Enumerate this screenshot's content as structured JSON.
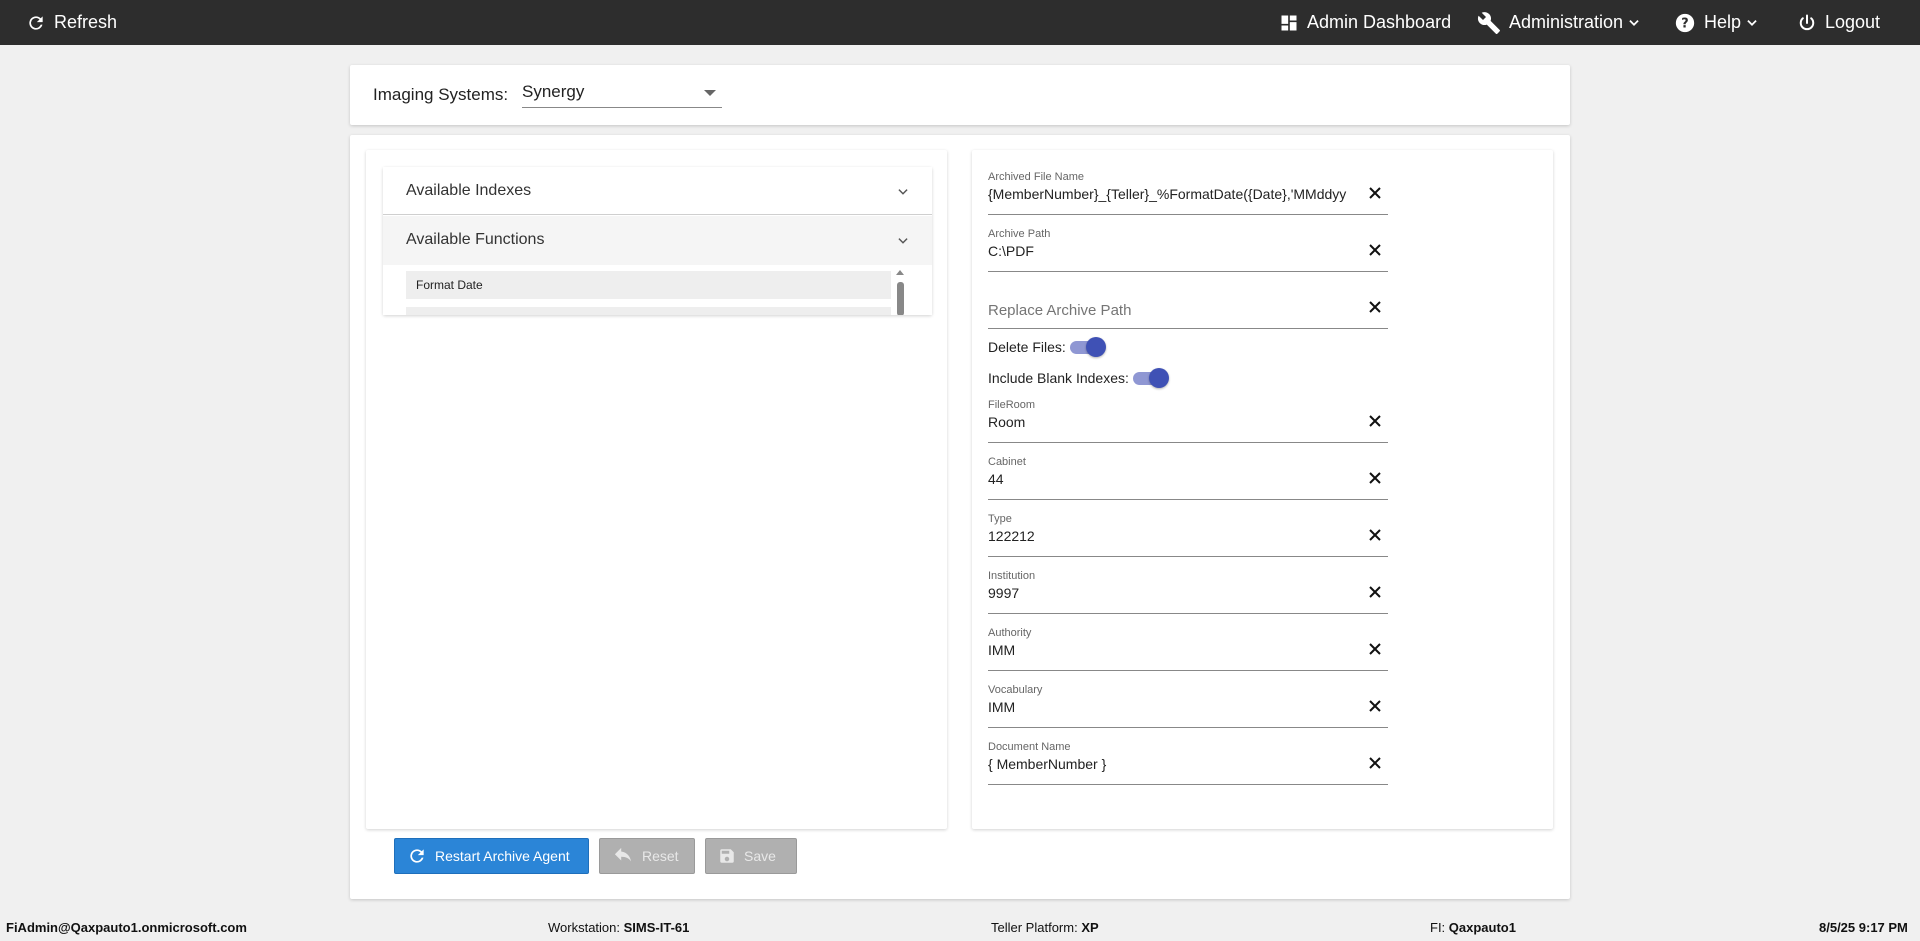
{
  "topbar": {
    "refresh_label": "Refresh",
    "admin_dashboard_label": "Admin Dashboard",
    "administration_label": "Administration",
    "help_label": "Help",
    "logout_label": "Logout"
  },
  "imaging": {
    "label": "Imaging Systems:",
    "selected": "Synergy"
  },
  "accordion": {
    "indexes_title": "Available Indexes",
    "functions_title": "Available Functions",
    "functions": [
      "Format Date"
    ]
  },
  "fields": {
    "archived_file_name": {
      "label": "Archived File Name",
      "value": "{MemberNumber}_{Teller}_%FormatDate({Date},'MMddyy"
    },
    "archive_path": {
      "label": "Archive Path",
      "value": "C:\\PDF"
    },
    "replace_archive_path": {
      "placeholder": "Replace Archive Path"
    },
    "fileroom": {
      "label": "FileRoom",
      "value": "Room"
    },
    "cabinet": {
      "label": "Cabinet",
      "value": "44"
    },
    "type": {
      "label": "Type",
      "value": "122212"
    },
    "institution": {
      "label": "Institution",
      "value": "9997"
    },
    "authority": {
      "label": "Authority",
      "value": "IMM"
    },
    "vocabulary": {
      "label": "Vocabulary",
      "value": "IMM"
    },
    "document_name": {
      "label": "Document Name",
      "value": "{ MemberNumber }"
    }
  },
  "toggles": {
    "delete_files": {
      "label": "Delete Files:",
      "on": true
    },
    "include_blank_indexes": {
      "label": "Include Blank Indexes:",
      "on": true
    }
  },
  "buttons": {
    "restart_label": "Restart Archive Agent",
    "reset_label": "Reset",
    "save_label": "Save"
  },
  "footer": {
    "user": "FiAdmin@Qaxpauto1.onmicrosoft.com",
    "workstation_label": "Workstation:",
    "workstation": "SIMS-IT-61",
    "teller_platform_label": "Teller Platform:",
    "teller_platform": "XP",
    "fi_label": "FI:",
    "fi": "Qaxpauto1",
    "datetime": "8/5/25 9:17 PM"
  },
  "colors": {
    "topbar": "#2d2d2d",
    "primary_button": "#2b85d7",
    "toggle_knob": "#3f51b5",
    "toggle_track": "#8f97d3",
    "disabled_button": "#b0b0b0"
  },
  "icons": [
    "refresh-icon",
    "dashboard-icon",
    "wrench-icon",
    "help-icon",
    "power-icon",
    "chevron-down-icon",
    "close-icon",
    "undo-icon",
    "save-icon"
  ]
}
